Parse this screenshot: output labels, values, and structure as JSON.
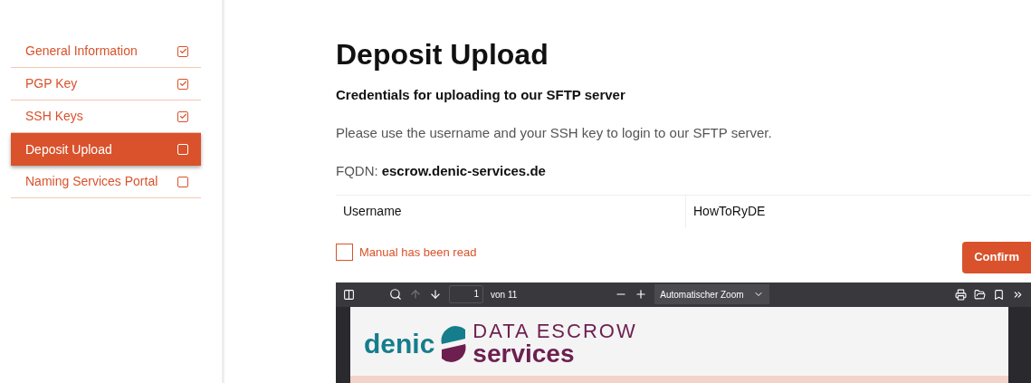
{
  "sidebar": {
    "items": [
      {
        "label": "General Information",
        "checked": true,
        "selected": false
      },
      {
        "label": "PGP Key",
        "checked": true,
        "selected": false
      },
      {
        "label": "SSH Keys",
        "checked": true,
        "selected": false
      },
      {
        "label": "Deposit Upload",
        "checked": false,
        "selected": true
      },
      {
        "label": "Naming Services Portal",
        "checked": false,
        "selected": false
      }
    ]
  },
  "main": {
    "title": "Deposit Upload",
    "subtitle": "Credentials for uploading to our SFTP server",
    "description": "Please use the username and your SSH key to login to our SFTP server.",
    "fqdn": {
      "label": "FQDN:",
      "value": "escrow.denic-services.de"
    },
    "credentials": [
      {
        "label": "Username",
        "value": "HowToRyDE"
      }
    ],
    "manual_checkbox": {
      "label": "Manual has been read",
      "checked": false
    },
    "confirm_button": "Confirm",
    "pdf_viewer": {
      "page_input": "1",
      "page_count": "von 11",
      "zoom": "Automatischer Zoom",
      "document": {
        "brand": "denic",
        "line1": "DATA ESCROW",
        "line2": "services"
      }
    }
  }
}
